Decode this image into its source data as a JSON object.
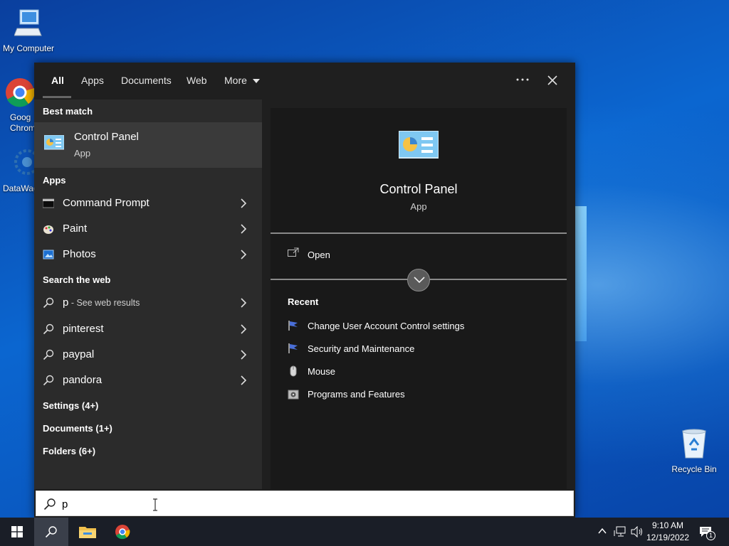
{
  "desktop": {
    "icons": [
      {
        "label": "My Computer"
      },
      {
        "label": "Goog Chrom"
      },
      {
        "label": "DataWag"
      },
      {
        "label": "Recycle Bin"
      }
    ]
  },
  "search": {
    "tabs": [
      {
        "label": "All"
      },
      {
        "label": "Apps"
      },
      {
        "label": "Documents"
      },
      {
        "label": "Web"
      },
      {
        "label": "More"
      }
    ],
    "best_match": {
      "heading": "Best match",
      "title": "Control Panel",
      "subtitle": "App"
    },
    "apps": {
      "heading": "Apps",
      "items": [
        {
          "label": "Command Prompt"
        },
        {
          "label": "Paint"
        },
        {
          "label": "Photos"
        }
      ]
    },
    "web": {
      "heading": "Search the web",
      "items": [
        {
          "label": "p",
          "suffix": " - See web results"
        },
        {
          "label": "pinterest"
        },
        {
          "label": "paypal"
        },
        {
          "label": "pandora"
        }
      ]
    },
    "more_sections": [
      {
        "label": "Settings (4+)"
      },
      {
        "label": "Documents (1+)"
      },
      {
        "label": "Folders (6+)"
      }
    ],
    "preview": {
      "title": "Control Panel",
      "subtitle": "App",
      "open_label": "Open",
      "recent_heading": "Recent",
      "recent": [
        {
          "label": "Change User Account Control settings"
        },
        {
          "label": "Security and Maintenance"
        },
        {
          "label": "Mouse"
        },
        {
          "label": "Programs and Features"
        }
      ]
    },
    "query": "p"
  },
  "taskbar": {
    "time": "9:10 AM",
    "date": "12/19/2022",
    "notification_count": "1"
  }
}
